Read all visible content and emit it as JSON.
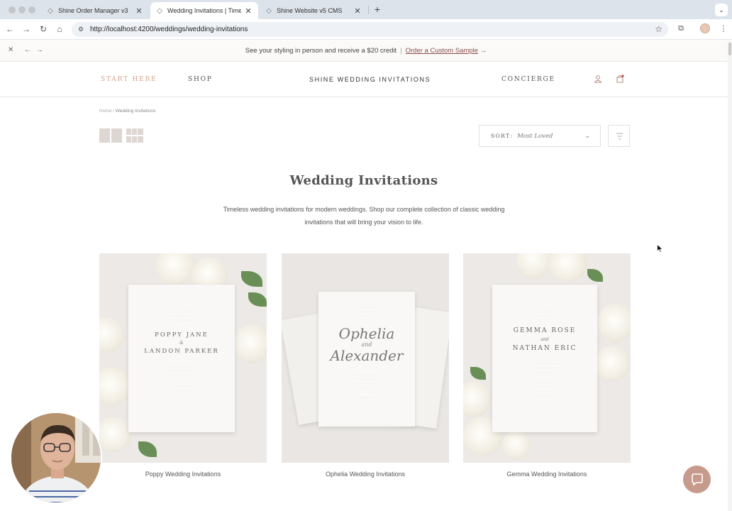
{
  "browser": {
    "tabs": [
      {
        "label": "Shine Order Manager v3",
        "active": false
      },
      {
        "label": "Wedding Invitations | Timeless",
        "active": true
      },
      {
        "label": "Shine Website v5 CMS",
        "active": false
      }
    ],
    "url": "http://localhost:4200/weddings/wedding-invitations"
  },
  "promo": {
    "text": "See your styling in person and receive a $20 credit",
    "separator": "|",
    "link": "Order a Custom Sample",
    "link_arrow": "→"
  },
  "header": {
    "start_here": "START HERE",
    "shop": "SHOP",
    "brand": "SHINE WEDDING INVITATIONS",
    "concierge": "CONCIERGE"
  },
  "breadcrumb": {
    "home": "Home",
    "separator": "/",
    "current": "Wedding Invitations"
  },
  "sort": {
    "label": "SORT:",
    "value": "Most Loved"
  },
  "page": {
    "title": "Wedding Invitations",
    "intro": "Timeless wedding invitations for modern weddings. Shop our complete collection of classic wedding invitations that will bring your vision to life."
  },
  "products": [
    {
      "name": "Poppy Wedding Invitations",
      "card_names": [
        "POPPY JANE",
        "&",
        "LANDON PARKER"
      ]
    },
    {
      "name": "Ophelia Wedding Invitations",
      "card_names": [
        "Ophelia",
        "and",
        "Alexander"
      ]
    },
    {
      "name": "Gemma Wedding Invitations",
      "card_names": [
        "GEMMA ROSE",
        "and",
        "NATHAN ERIC"
      ]
    }
  ],
  "colors": {
    "accent": "#d7a08a",
    "chat_button": "#c79b8c",
    "promo_link": "#8a4b4b"
  }
}
